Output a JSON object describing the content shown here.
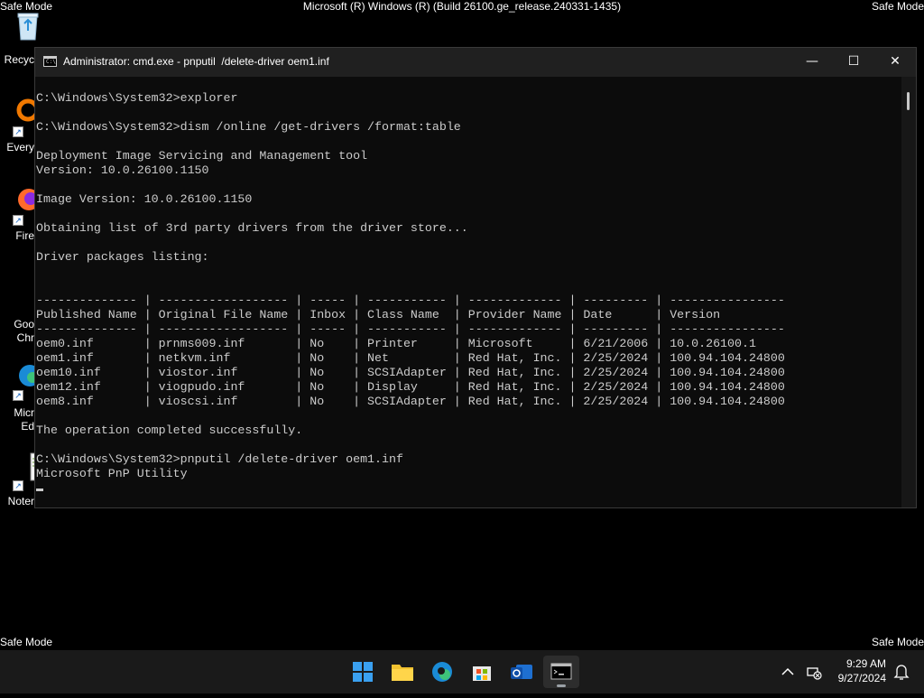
{
  "desktop": {
    "safe_mode": "Safe Mode",
    "build": "Microsoft (R) Windows (R) (Build 26100.ge_release.240331-1435)",
    "icons": [
      {
        "name": "recycle-bin-icon",
        "label": "Recyc"
      },
      {
        "name": "everything-icon",
        "label": "Every"
      },
      {
        "name": "firefox-icon",
        "label": "Fire"
      },
      {
        "name": "google-chrome-icon",
        "label": "Goo\nChr"
      },
      {
        "name": "microsoft-edge-icon",
        "label": "Micr\nEd"
      },
      {
        "name": "notepad-icon",
        "label": "Noter"
      }
    ]
  },
  "window": {
    "title": "Administrator: cmd.exe - pnputil  /delete-driver oem1.inf",
    "minimize": "—",
    "maximize": "☐",
    "close": "✕",
    "console_lines": [
      "",
      "C:\\Windows\\System32>explorer",
      "",
      "C:\\Windows\\System32>dism /online /get-drivers /format:table",
      "",
      "Deployment Image Servicing and Management tool",
      "Version: 10.0.26100.1150",
      "",
      "Image Version: 10.0.26100.1150",
      "",
      "Obtaining list of 3rd party drivers from the driver store...",
      "",
      "Driver packages listing:",
      "",
      "",
      "-------------- | ------------------ | ----- | ----------- | ------------- | --------- | ----------------",
      "Published Name | Original File Name | Inbox | Class Name  | Provider Name | Date      | Version",
      "-------------- | ------------------ | ----- | ----------- | ------------- | --------- | ----------------",
      "oem0.inf       | prnms009.inf       | No    | Printer     | Microsoft     | 6/21/2006 | 10.0.26100.1",
      "oem1.inf       | netkvm.inf         | No    | Net         | Red Hat, Inc. | 2/25/2024 | 100.94.104.24800",
      "oem10.inf      | viostor.inf        | No    | SCSIAdapter | Red Hat, Inc. | 2/25/2024 | 100.94.104.24800",
      "oem12.inf      | viogpudo.inf       | No    | Display     | Red Hat, Inc. | 2/25/2024 | 100.94.104.24800",
      "oem8.inf       | vioscsi.inf        | No    | SCSIAdapter | Red Hat, Inc. | 2/25/2024 | 100.94.104.24800",
      "",
      "The operation completed successfully.",
      "",
      "C:\\Windows\\System32>pnputil /delete-driver oem1.inf",
      "Microsoft PnP Utility",
      ""
    ]
  },
  "taskbar": {
    "apps": [
      "start-button",
      "file-explorer-icon",
      "edge-icon",
      "store-icon",
      "outlook-icon",
      "terminal-icon"
    ],
    "time": "9:29 AM",
    "date": "9/27/2024"
  }
}
